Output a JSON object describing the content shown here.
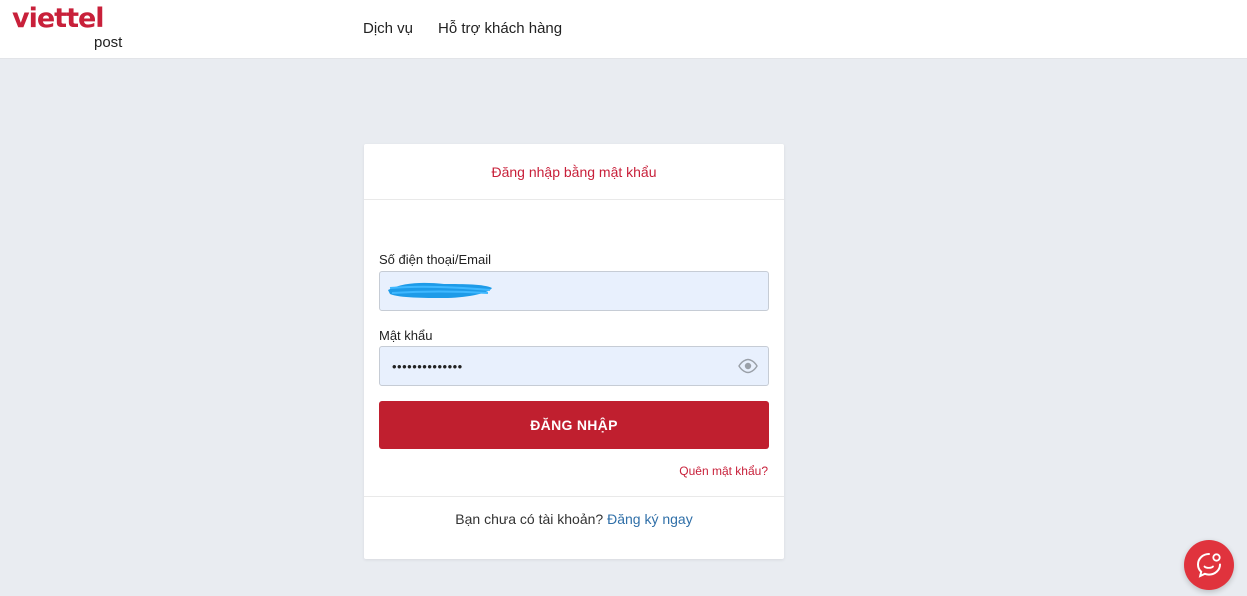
{
  "brand": {
    "name": "viettel",
    "sub": "post",
    "color": "#c8203a"
  },
  "nav": {
    "items": [
      {
        "label": "Dịch vụ"
      },
      {
        "label": "Hỗ trợ khách hàng"
      }
    ]
  },
  "login": {
    "title": "Đăng nhập bằng mật khẩu",
    "username_label": "Số điện thoại/Email",
    "username_value": "",
    "password_label": "Mật khẩu",
    "password_value": "••••••••••••••",
    "submit_label": "ĐĂNG NHẬP",
    "forgot_label": "Quên mật khẩu?",
    "signup_prompt": "Bạn chưa có tài khoản?",
    "signup_link": "Đăng ký ngay"
  },
  "icons": {
    "password_toggle": "eye-icon",
    "chat": "chat-icon"
  },
  "colors": {
    "accent": "#c01f2f",
    "link": "#2f6fa8",
    "background": "#e9ecf1",
    "input_bg": "#e8f0fd"
  }
}
